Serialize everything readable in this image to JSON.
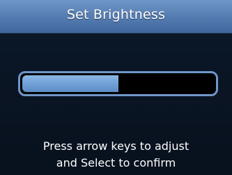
{
  "dialog": {
    "title": "Set Brightness"
  },
  "brightness": {
    "level_fraction": 0.5
  },
  "instructions": {
    "line1": "Press arrow keys to adjust",
    "line2": "and Select to confirm"
  }
}
